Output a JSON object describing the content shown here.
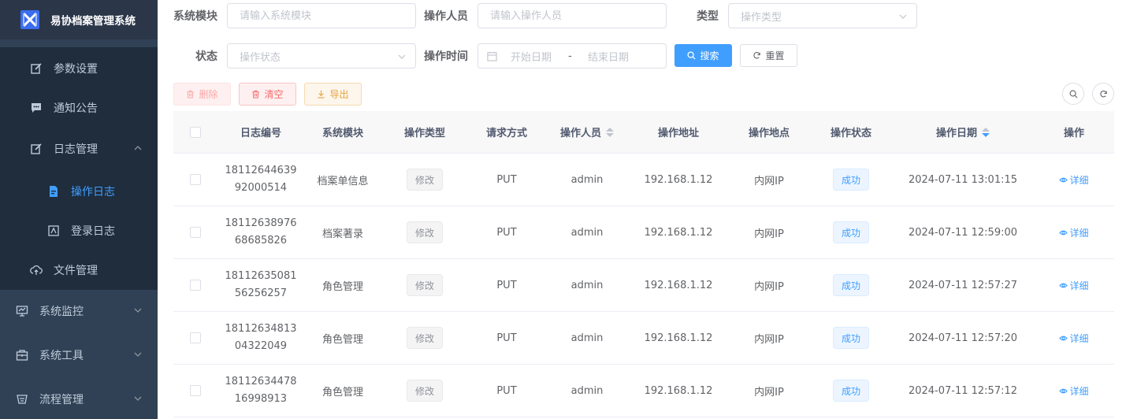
{
  "app": {
    "title": "易协档案管理系统"
  },
  "sidebar": {
    "items": [
      {
        "label": "参数设置",
        "icon": "edit-icon"
      },
      {
        "label": "通知公告",
        "icon": "message-icon"
      },
      {
        "label": "日志管理",
        "icon": "log-icon"
      },
      {
        "label": "操作日志",
        "icon": "form-icon"
      },
      {
        "label": "登录日志",
        "icon": "logininfor-icon"
      },
      {
        "label": "文件管理",
        "icon": "upload-icon"
      },
      {
        "label": "系统监控",
        "icon": "monitor-icon"
      },
      {
        "label": "系统工具",
        "icon": "tool-icon"
      },
      {
        "label": "流程管理",
        "icon": "flow-icon"
      }
    ],
    "active_color": "#409eff"
  },
  "search": {
    "module_label": "系统模块",
    "module_placeholder": "请输入系统模块",
    "operator_label": "操作人员",
    "operator_placeholder": "请输入操作人员",
    "type_label": "类型",
    "type_placeholder": "操作类型",
    "status_label": "状态",
    "status_placeholder": "操作状态",
    "time_label": "操作时间",
    "start_placeholder": "开始日期",
    "range_separator": "-",
    "end_placeholder": "结束日期",
    "search_button": "搜索",
    "reset_button": "重置"
  },
  "toolbar": {
    "delete": "删除",
    "clean": "清空",
    "export": "导出"
  },
  "table": {
    "columns": [
      "日志编号",
      "系统模块",
      "操作类型",
      "请求方式",
      "操作人员",
      "操作地址",
      "操作地点",
      "操作状态",
      "操作日期",
      "操作"
    ],
    "rows": [
      {
        "id1": "18112644639",
        "id2": "92000514",
        "module": "档案单信息",
        "type": "修改",
        "method": "PUT",
        "operator": "admin",
        "ip": "192.168.1.12",
        "location": "内网IP",
        "status": "成功",
        "time": "2024-07-11 13:01:15",
        "action": "详细"
      },
      {
        "id1": "18112638976",
        "id2": "68685826",
        "module": "档案著录",
        "type": "修改",
        "method": "PUT",
        "operator": "admin",
        "ip": "192.168.1.12",
        "location": "内网IP",
        "status": "成功",
        "time": "2024-07-11 12:59:00",
        "action": "详细"
      },
      {
        "id1": "18112635081",
        "id2": "56256257",
        "module": "角色管理",
        "type": "修改",
        "method": "PUT",
        "operator": "admin",
        "ip": "192.168.1.12",
        "location": "内网IP",
        "status": "成功",
        "time": "2024-07-11 12:57:27",
        "action": "详细"
      },
      {
        "id1": "18112634813",
        "id2": "04322049",
        "module": "角色管理",
        "type": "修改",
        "method": "PUT",
        "operator": "admin",
        "ip": "192.168.1.12",
        "location": "内网IP",
        "status": "成功",
        "time": "2024-07-11 12:57:20",
        "action": "详细"
      },
      {
        "id1": "18112634478",
        "id2": "16998913",
        "module": "角色管理",
        "type": "修改",
        "method": "PUT",
        "operator": "admin",
        "ip": "192.168.1.12",
        "location": "内网IP",
        "status": "成功",
        "time": "2024-07-11 12:57:12",
        "action": "详细"
      }
    ]
  }
}
